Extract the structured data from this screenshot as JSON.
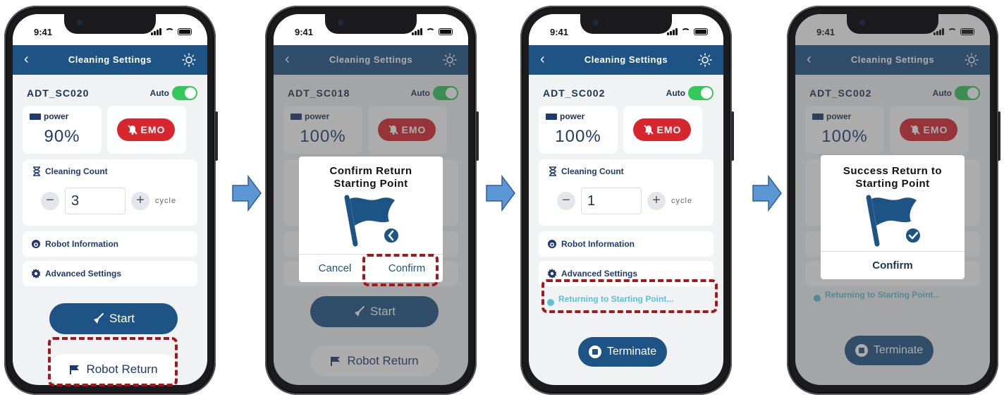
{
  "colors": {
    "nav": "#1e5485",
    "accent_green": "#34c759",
    "emo_red": "#d7262e",
    "highlight": "#a3171d",
    "arrow": "#5b97d4",
    "returning_text": "#58c2d8"
  },
  "status": {
    "time": "9:41"
  },
  "nav": {
    "title": "Cleaning Settings",
    "back_icon": "chevron-left-icon",
    "right_icon": "sun-icon"
  },
  "common": {
    "auto_label": "Auto",
    "power_label": "power",
    "emo_label": "EMO",
    "count_label": "Cleaning Count",
    "cycle_label": "cycle",
    "minus": "−",
    "plus": "+",
    "robot_info": "Robot Information",
    "advanced": "Advanced Settings",
    "start": "Start",
    "robot_return": "Robot Return",
    "terminate": "Terminate",
    "returning": "Returning to Starting Point..."
  },
  "screen1": {
    "device": "ADT_SC020",
    "power": "90%",
    "count": "3"
  },
  "screen2": {
    "device": "ADT_SC018",
    "power": "100%",
    "dialog": {
      "title_line1": "Confirm Return",
      "title_line2": "Starting Point",
      "cancel": "Cancel",
      "confirm": "Confirm"
    }
  },
  "screen3": {
    "device": "ADT_SC002",
    "power": "100%",
    "count": "1"
  },
  "screen4": {
    "device": "ADT_SC002",
    "power": "100%",
    "dialog": {
      "title_line1": "Success Return to",
      "title_line2": "Starting Point",
      "confirm": "Confirm"
    }
  }
}
